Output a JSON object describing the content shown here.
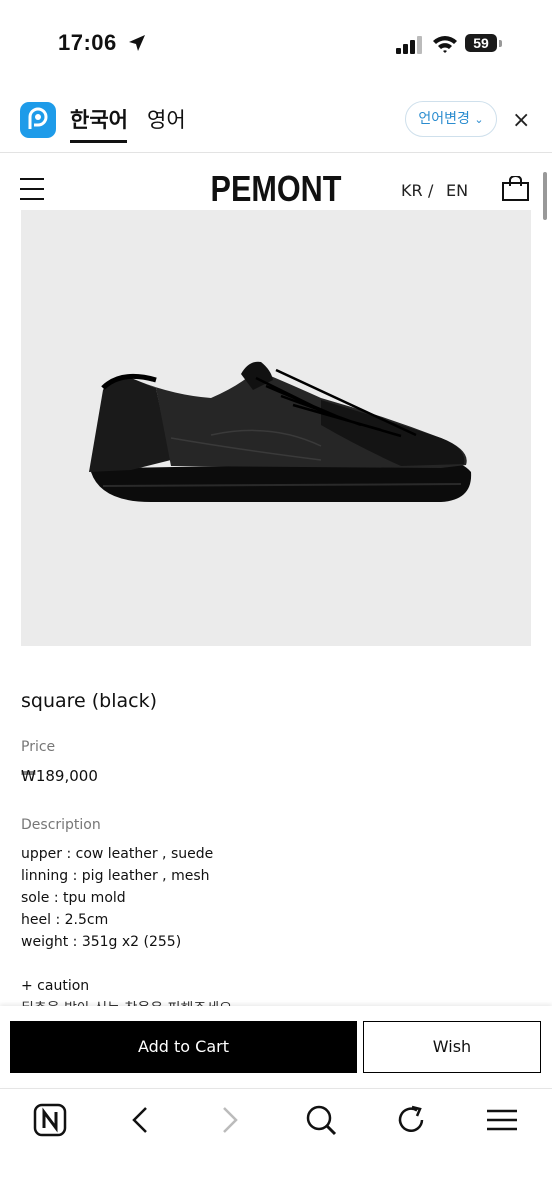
{
  "status_bar": {
    "time": "17:06",
    "battery": "59"
  },
  "translate_bar": {
    "source_lang": "한국어",
    "target_lang": "영어",
    "change_label": "언어변경",
    "close_label": "×"
  },
  "site_header": {
    "brand": "PEMONT",
    "lang_kr": "KR",
    "lang_sep": "/",
    "lang_en": "EN"
  },
  "product": {
    "name": "square (black)",
    "price_label": "Price",
    "price": "₩189,000",
    "description_label": "Description",
    "description_lines": [
      "upper : cow leather , suede",
      "linning : pig leather , mesh",
      "sole : tpu mold",
      "heel : 2.5cm",
      "weight : 351g x2 (255)"
    ],
    "caution": "+ caution",
    "caution_text": "뒤축을 밟아 신는 착용은 피해주세요"
  },
  "actions": {
    "add_to_cart": "Add to Cart",
    "wish": "Wish"
  },
  "browser_nav": {
    "icons": [
      "naver-home-icon",
      "back-icon",
      "forward-icon",
      "search-icon",
      "reload-icon",
      "menu-icon"
    ]
  }
}
